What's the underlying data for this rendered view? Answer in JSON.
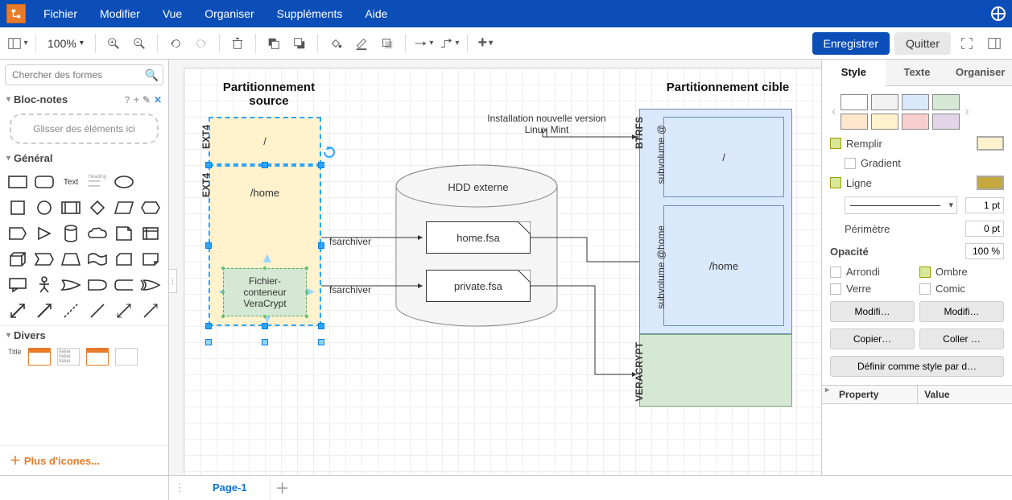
{
  "menu": {
    "items": [
      "Fichier",
      "Modifier",
      "Vue",
      "Organiser",
      "Suppléments",
      "Aide"
    ]
  },
  "toolbar": {
    "zoom": "100%",
    "save": "Enregistrer",
    "quit": "Quitter"
  },
  "left": {
    "search_placeholder": "Chercher des formes",
    "scratchpad_title": "Bloc-notes",
    "drop_hint": "Glisser des éléments ici",
    "general_title": "Général",
    "shape_text_label": "Text",
    "more_icons": "Plus d'icones...",
    "divers_title": "Divers",
    "title_label": "Title"
  },
  "diagram": {
    "source_title": "Partitionnement source",
    "target_title": "Partitionnement cible",
    "ext4_a": "EXT4",
    "ext4_b": "EXT4",
    "root": "/",
    "home": "/home",
    "veracrypt_box": "Fichier-\nconteneur\nVeraCrypt",
    "hdd": "HDD externe",
    "home_fsa": "home.fsa",
    "private_fsa": "private.fsa",
    "install_note": "Installation nouvelle version Linux Mint",
    "fsarchiver1": "fsarchiver",
    "fsarchiver2": "fsarchiver",
    "btrfs": "BTRFS",
    "subvol_root": "subvolume @",
    "subvol_home": "subvolume @home",
    "veracrypt_label": "VERACRYPT",
    "target_root": "/",
    "target_home": "/home"
  },
  "right": {
    "tabs": {
      "style": "Style",
      "text": "Texte",
      "arrange": "Organiser"
    },
    "fill_label": "Remplir",
    "gradient_label": "Gradient",
    "line_label": "Ligne",
    "line_width": "1 pt",
    "perimeter_label": "Périmètre",
    "perimeter_val": "0 pt",
    "opacity_label": "Opacité",
    "opacity_val": "100 %",
    "rounded": "Arrondi",
    "shadow": "Ombre",
    "glass": "Verre",
    "comic": "Comic",
    "edit1": "Modifi…",
    "edit2": "Modifi…",
    "copy": "Copier…",
    "paste": "Coller …",
    "default_style": "Définir comme style par d…",
    "prop_header": "Property",
    "val_header": "Value",
    "fill_color": "#FFF2CC",
    "line_color": "#B8A33A"
  },
  "footer": {
    "page": "Page-1"
  },
  "colors": {
    "accent": "#0B4EB8",
    "yellow_fill": "#FFF2CC",
    "blue_fill": "#DAE8FC",
    "green_fill": "#D5E8D4",
    "grey_fill": "#F5F5F5"
  }
}
